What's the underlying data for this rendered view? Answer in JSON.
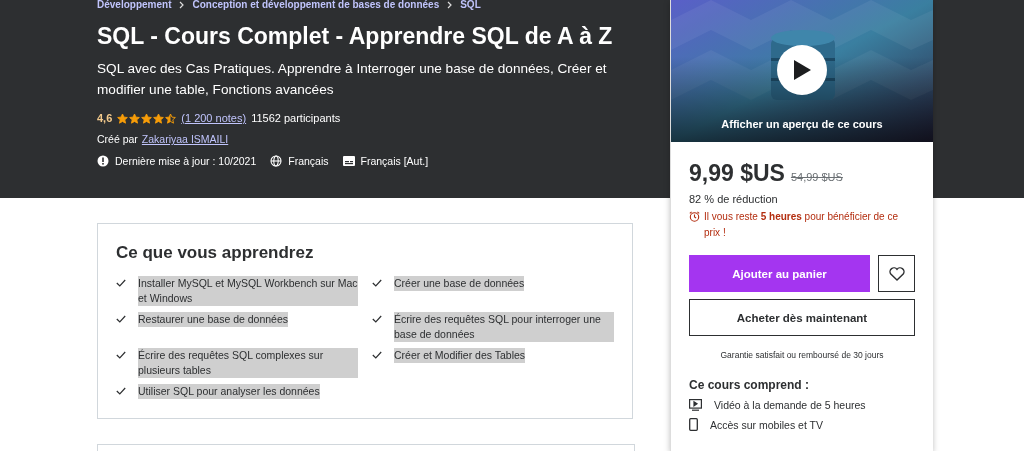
{
  "breadcrumb": [
    "Développement",
    "Conception et développement de bases de données",
    "SQL"
  ],
  "title": "SQL - Cours Complet - Apprendre SQL de A à Z",
  "subtitle": "SQL avec des Cas Pratiques. Apprendre à Interroger une base de données, Créer et modifier une table, Fonctions avancées",
  "rating": {
    "value": "4,6",
    "stars": 4.5,
    "count": "(1 200 notes)",
    "participants": "11562 participants"
  },
  "author": {
    "label": "Créé par",
    "name": "Zakariyaa ISMAILI"
  },
  "meta": [
    {
      "kind": "update",
      "text": "Dernière mise à jour : 10/2021"
    },
    {
      "kind": "language",
      "text": "Français"
    },
    {
      "kind": "captions",
      "text": "Français [Aut.]"
    }
  ],
  "learn": {
    "title": "Ce que vous apprendrez",
    "items": [
      {
        "text": "Installer MySQL et MySQL Workbench sur Mac et Windows",
        "highlighted": true
      },
      {
        "text": "Créer une base de données",
        "highlighted": true
      },
      {
        "text": "Restaurer une base de données",
        "highlighted": true
      },
      {
        "text": "Écrire des requêtes SQL pour interroger une base de données",
        "highlighted": true
      },
      {
        "text": "Écrire des requêtes SQL complexes sur plusieurs tables",
        "highlighted": true
      },
      {
        "text": "Créer et Modifier des Tables",
        "highlighted": true
      },
      {
        "text": "Utiliser SQL pour analyser les données",
        "highlighted": true
      }
    ]
  },
  "sidebar": {
    "preview": "Afficher un aperçu de ce cours",
    "price": "9,99 $US",
    "old_price": "54,99 $US",
    "discount": "82 % de réduction",
    "countdown": "Il vous reste **5 heures** pour bénéficier de ce prix !",
    "add_to_cart": "Ajouter au panier",
    "buy_now": "Acheter dès maintenant",
    "guarantee": "Garantie satisfait ou remboursé de 30 jours",
    "includes_title": "Ce cours comprend :",
    "includes": [
      {
        "kind": "video",
        "text": "Vidéo à la demande de 5 heures"
      },
      {
        "kind": "mobile",
        "text": "Accès sur mobiles et TV"
      }
    ]
  }
}
